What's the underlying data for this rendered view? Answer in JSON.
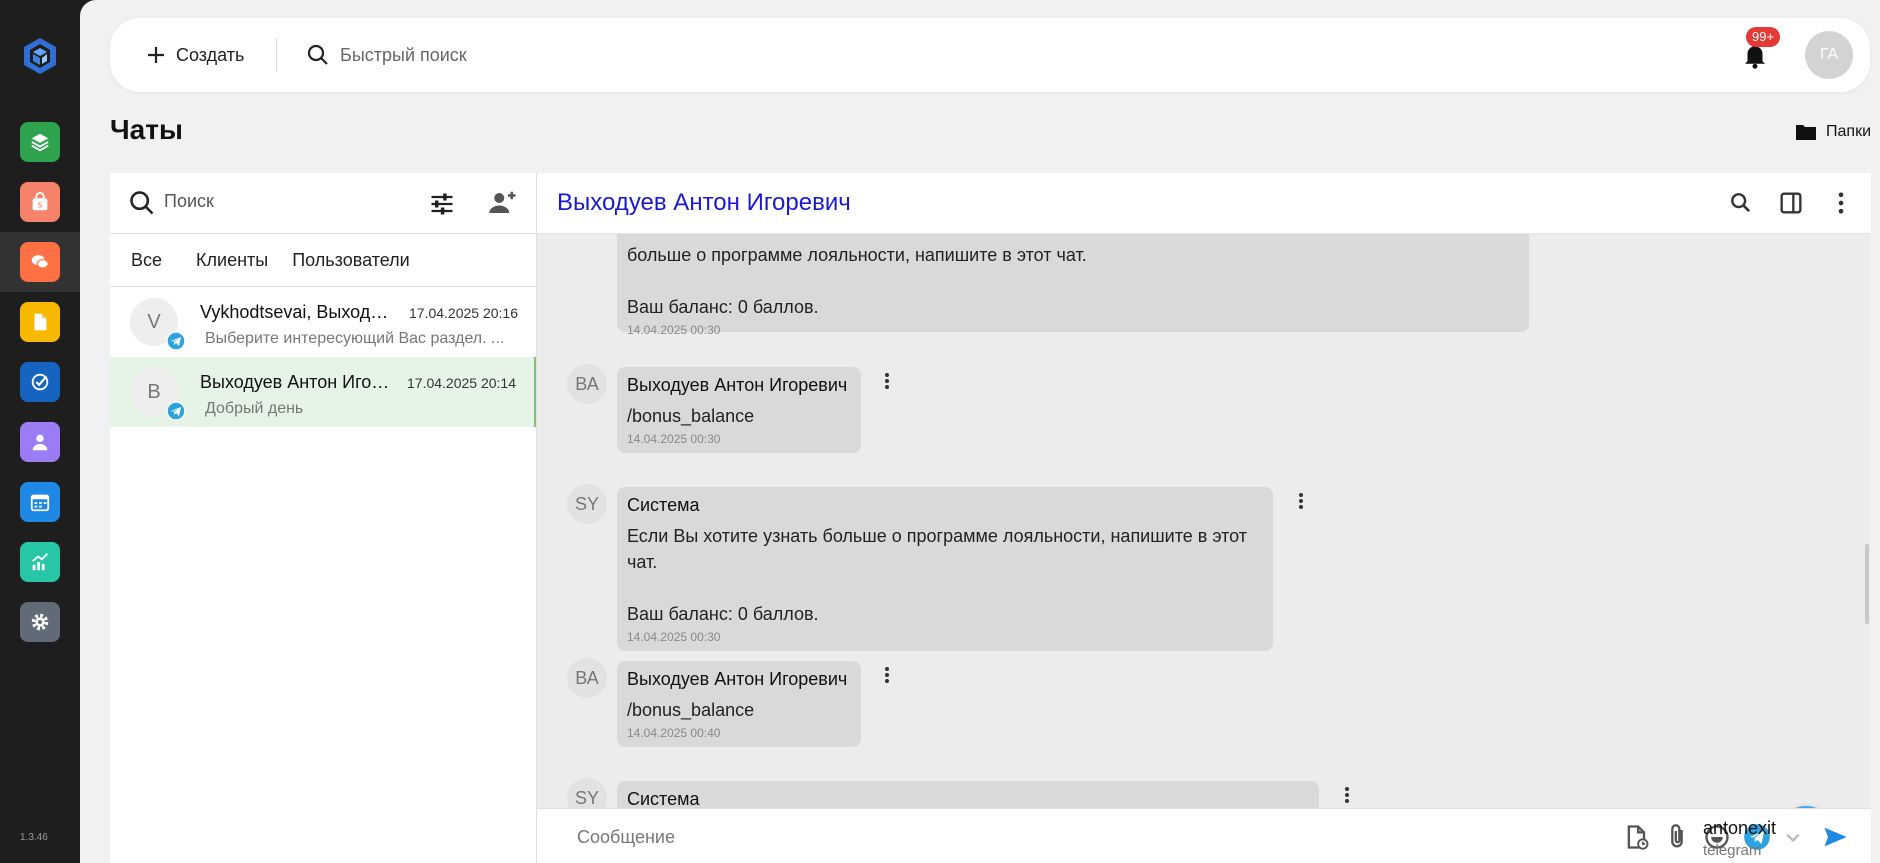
{
  "app": {
    "version": "1.3.46",
    "nav": [
      {
        "name": "layers-icon",
        "color": "#2ea44f"
      },
      {
        "name": "shopping-bag-icon",
        "color": "#f4836a"
      },
      {
        "name": "chat-icon",
        "color": "#ff7043",
        "active": true
      },
      {
        "name": "document-icon",
        "color": "#f9b800"
      },
      {
        "name": "task-check-icon",
        "color": "#1565c0"
      },
      {
        "name": "user-icon",
        "color": "#9c7cf4"
      },
      {
        "name": "calendar-icon",
        "color": "#1e88e5"
      },
      {
        "name": "analytics-icon",
        "color": "#26c6a6"
      },
      {
        "name": "settings-icon",
        "color": "#616b77"
      }
    ]
  },
  "topbar": {
    "create_label": "Создать",
    "search_placeholder": "Быстрый поиск",
    "notifications_badge": "99+",
    "user_initials": "ГА"
  },
  "page": {
    "title": "Чаты",
    "folders_label": "Папки"
  },
  "chat_list": {
    "search_placeholder": "Поиск",
    "tabs": [
      "Все",
      "Клиенты",
      "Пользователи"
    ],
    "items": [
      {
        "initial": "V",
        "name": "Vykhodtsevai, Выходуев Антон",
        "time": "17.04.2025 20:16",
        "preview": "Выберите интересующий Вас раздел.  ...",
        "active": false
      },
      {
        "initial": "В",
        "name": "Выходуев Антон Игоревич",
        "time": "17.04.2025 20:14",
        "preview": "Добрый день",
        "active": true
      }
    ]
  },
  "conversation": {
    "title": "Выходуев Антон Игоревич",
    "messages": [
      {
        "initials": "",
        "sender": "",
        "text": "больше о программе лояльности, напишите в этот чат.\n\nВаш баланс: 0 баллов.",
        "time": "14.04.2025 00:30"
      },
      {
        "initials": "ВА",
        "sender": "Выходуев Антон Игоревич",
        "text": "/bonus_balance",
        "time": "14.04.2025 00:30"
      },
      {
        "initials": "SY",
        "sender": "Система",
        "text": "Если Вы хотите узнать больше о программе лояльности, напишите в этот чат.\n\nВаш баланс: 0 баллов.",
        "time": "14.04.2025 00:30"
      },
      {
        "initials": "ВА",
        "sender": "Выходуев Антон Игоревич",
        "text": "/bonus_balance",
        "time": "14.04.2025 00:40"
      },
      {
        "initials": "SY",
        "sender": "Система",
        "text": "",
        "time": ""
      }
    ],
    "composer": {
      "placeholder": "Сообщение",
      "account_name": "antonexit",
      "account_channel": "telegram"
    }
  }
}
